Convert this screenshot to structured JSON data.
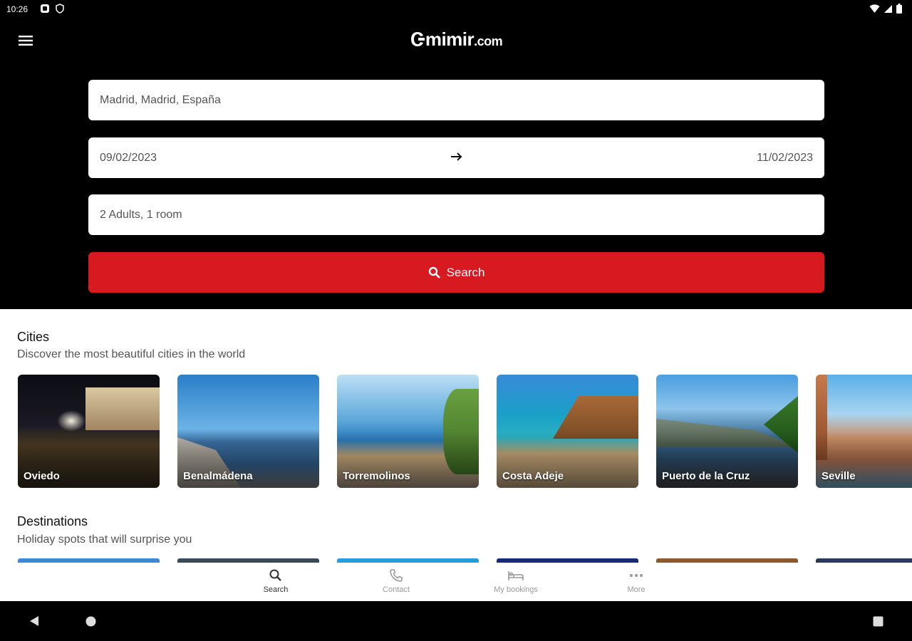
{
  "status": {
    "time": "10:26"
  },
  "header": {
    "logo_main": "mimir",
    "logo_domain": ".com",
    "destination_value": "Madrid, Madrid, España",
    "checkin": "09/02/2023",
    "checkout": "11/02/2023",
    "guests_value": "2 Adults, 1 room",
    "search_label": "Search"
  },
  "cities": {
    "title": "Cities",
    "subtitle": "Discover the most beautiful cities in the world",
    "items": [
      {
        "name": "Oviedo"
      },
      {
        "name": "Benalmádena"
      },
      {
        "name": "Torremolinos"
      },
      {
        "name": "Costa Adeje"
      },
      {
        "name": "Puerto de la Cruz"
      },
      {
        "name": "Seville"
      }
    ]
  },
  "destinations": {
    "title": "Destinations",
    "subtitle": "Holiday spots that will surprise you"
  },
  "nav": {
    "search": "Search",
    "contact": "Contact",
    "bookings": "My bookings",
    "more": "More"
  },
  "colors": {
    "accent": "#d71920",
    "header_bg": "#000000"
  }
}
